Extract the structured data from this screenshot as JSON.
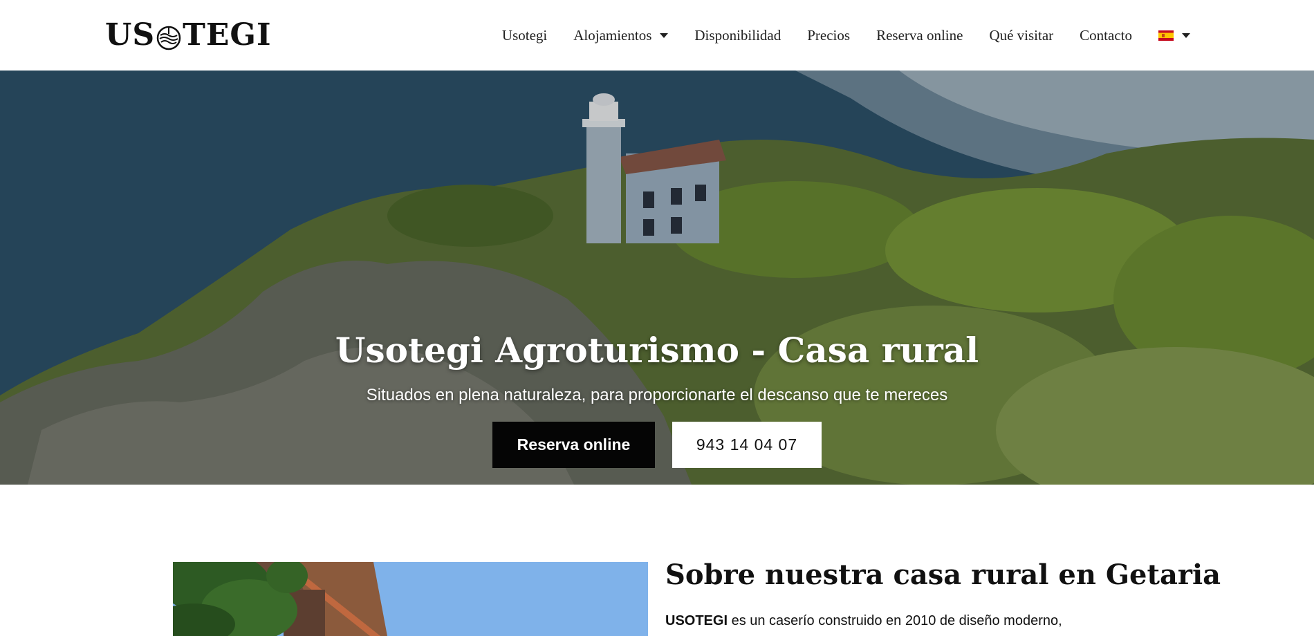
{
  "header": {
    "logo_text_left": "US",
    "logo_text_right": "TEGI",
    "nav": [
      {
        "label": "Usotegi"
      },
      {
        "label": "Alojamientos",
        "has_dropdown": true
      },
      {
        "label": "Disponibilidad"
      },
      {
        "label": "Precios"
      },
      {
        "label": "Reserva online"
      },
      {
        "label": "Qué visitar"
      },
      {
        "label": "Contacto"
      }
    ],
    "language_flag": "spain-flag-icon"
  },
  "hero": {
    "title": "Usotegi Agroturismo - Casa rural",
    "subtitle": "Situados en plena naturaleza, para proporcionarte el descanso que te mereces",
    "primary_button": "Reserva online",
    "phone_button": "943 14 04 07"
  },
  "about": {
    "title": "Sobre nuestra casa rural en Getaria",
    "text_bold": "USOTEGI",
    "text_rest": " es un caserío construido en 2010 de diseño moderno,"
  },
  "colors": {
    "primary_button_bg": "#050505",
    "text": "#111111",
    "sky": "#7fb2ea"
  }
}
